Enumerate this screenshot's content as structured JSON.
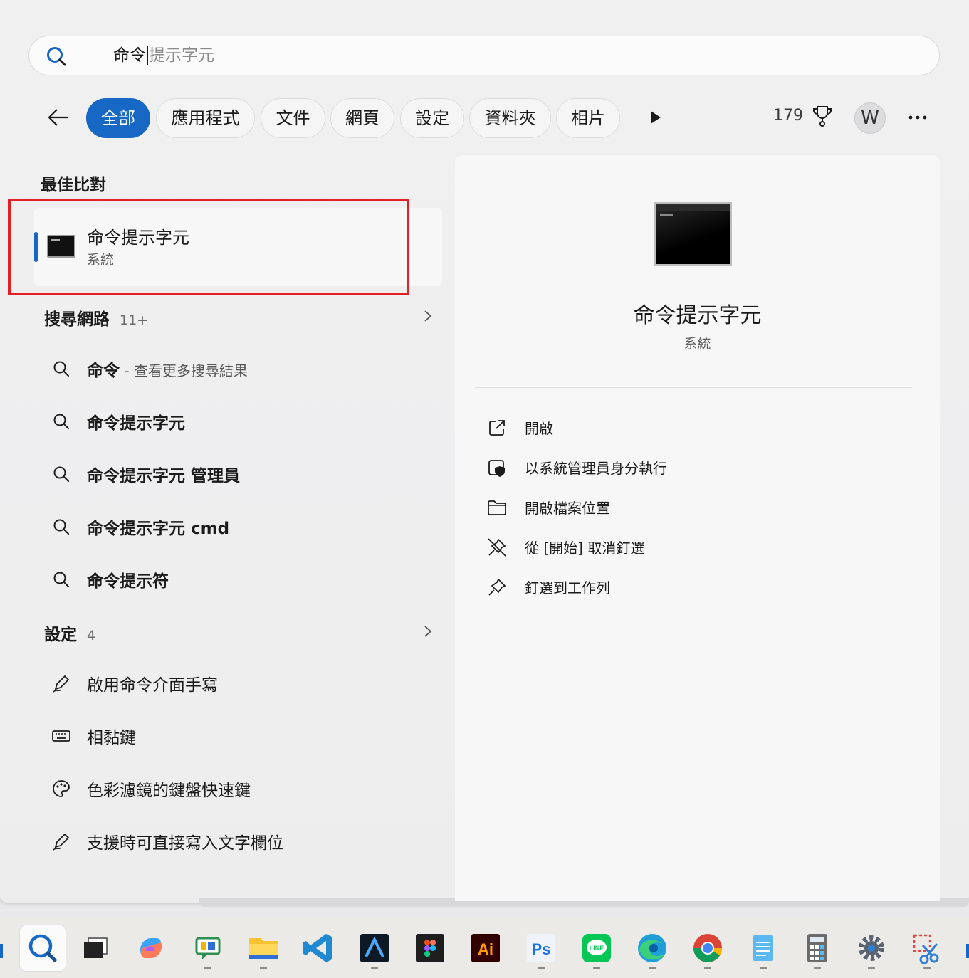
{
  "search": {
    "typed": "命令",
    "suggestion": "提示字元"
  },
  "filters": {
    "chips": [
      "全部",
      "應用程式",
      "文件",
      "網頁",
      "設定",
      "資料夾",
      "相片"
    ],
    "points": "179",
    "avatar_letter": "W"
  },
  "best_match": {
    "title": "最佳比對",
    "name": "命令提示字元",
    "subtitle": "系統"
  },
  "web": {
    "title": "搜尋網路",
    "count": "11+",
    "items": [
      {
        "label": "命令",
        "hint": " - 查看更多搜尋結果"
      },
      {
        "label": "命令提示字元"
      },
      {
        "label": "命令提示字元 管理員"
      },
      {
        "label": "命令提示字元 cmd"
      },
      {
        "label": "命令提示符"
      }
    ]
  },
  "settings": {
    "title": "設定",
    "count": "4",
    "items": [
      {
        "label": "啟用命令介面手寫",
        "icon": "pen-icon"
      },
      {
        "label": "相黏鍵",
        "icon": "keyboard-icon"
      },
      {
        "label": "色彩濾鏡的鍵盤快速鍵",
        "icon": "palette-icon"
      },
      {
        "label": "支援時可直接寫入文字欄位",
        "icon": "pen-icon"
      }
    ]
  },
  "detail": {
    "name": "命令提示字元",
    "subtitle": "系統",
    "actions": [
      {
        "label": "開啟",
        "icon": "open-external-icon"
      },
      {
        "label": "以系統管理員身分執行",
        "icon": "shield-icon"
      },
      {
        "label": "開啟檔案位置",
        "icon": "folder-icon"
      },
      {
        "label": "從 [開始] 取消釘選",
        "icon": "unpin-icon"
      },
      {
        "label": "釘選到工作列",
        "icon": "pin-icon"
      }
    ]
  },
  "taskbar": {
    "apps": [
      "search",
      "task-view",
      "copilot",
      "chat",
      "file-explorer",
      "vscode",
      "arc",
      "figma",
      "illustrator",
      "photoshop",
      "line",
      "edge",
      "chrome",
      "notepad",
      "calculator",
      "settings",
      "snipping-tool"
    ],
    "illustrator_label": "Ai",
    "photoshop_label": "Ps",
    "line_label": "LINE"
  },
  "colors": {
    "accent": "#1767c4",
    "highlight": "#e31e24"
  }
}
